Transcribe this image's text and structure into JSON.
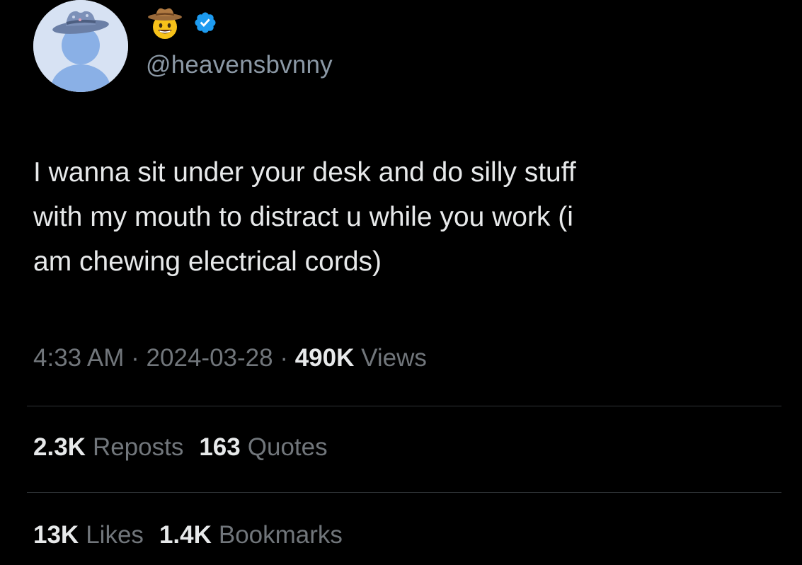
{
  "author": {
    "display_name_icon": "cowboy-hat-face-emoji",
    "verified_icon": "verified-badge-icon",
    "handle": "@heavensbvnny",
    "avatar_icon": "default-avatar-with-cowboy-hat"
  },
  "tweet": {
    "lines": [
      "I wanna sit under your desk and do silly stuff",
      "with my mouth to distract u while you work (i",
      "am chewing electrical cords)"
    ]
  },
  "meta": {
    "time": "4:33 AM",
    "separator": "·",
    "date": "2024-03-28",
    "views_count": "490K",
    "views_label": "Views"
  },
  "stats": {
    "reposts_count": "2.3K",
    "reposts_label": "Reposts",
    "quotes_count": "163",
    "quotes_label": "Quotes",
    "likes_count": "13K",
    "likes_label": "Likes",
    "bookmarks_count": "1.4K",
    "bookmarks_label": "Bookmarks"
  },
  "colors": {
    "background": "#000000",
    "primary_text": "#e7e9ea",
    "secondary_text": "#71767b",
    "verified_blue": "#1d9bf0",
    "divider": "#2f3336"
  }
}
